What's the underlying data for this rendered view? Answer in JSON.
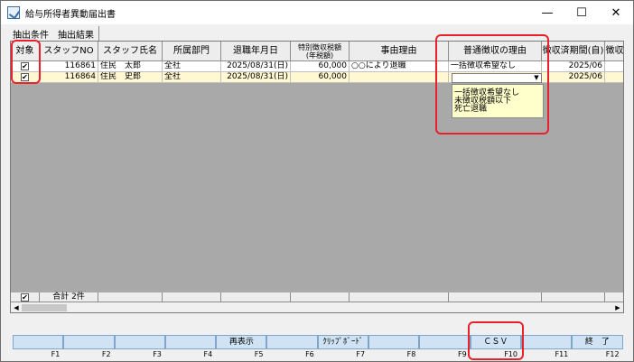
{
  "window": {
    "title": "給与所得者異動届出書",
    "minimize": "—",
    "maximize": "☐",
    "close": "✕"
  },
  "tabs": [
    {
      "label": "抽出条件"
    },
    {
      "label": "抽出結果"
    }
  ],
  "grid": {
    "columns": [
      {
        "label": "対象"
      },
      {
        "label": "スタッフNO"
      },
      {
        "label": "スタッフ氏名"
      },
      {
        "label": "所属部門"
      },
      {
        "label": "退職年月日"
      },
      {
        "label": "特別徴収税額",
        "label2": "(年税額)"
      },
      {
        "label": "事由理由"
      },
      {
        "label": "普通徴収の理由"
      },
      {
        "label": "徴収済期間(自)"
      },
      {
        "label": "徴収"
      }
    ],
    "rows": [
      {
        "checked": "✔",
        "staff_no": "116861",
        "name": "住民　太郎",
        "dept": "全社",
        "retire_date": "2025/08/31(日)",
        "tax": "60,000",
        "reason": "○○により退職",
        "normal_reason": "一括徴収希望なし",
        "period_from": "2025/06",
        "collect": ""
      },
      {
        "checked": "✔",
        "staff_no": "116864",
        "name": "住民　史郎",
        "dept": "全社",
        "retire_date": "2025/08/31(日)",
        "tax": "60,000",
        "reason": "",
        "normal_reason": "",
        "period_from": "2025/06",
        "collect": ""
      }
    ],
    "dropdown": {
      "arrow": "▼",
      "options": [
        "一括徴収希望なし",
        "未徴収税額以下",
        "死亡退職"
      ]
    },
    "summary": {
      "checked": "✔",
      "total": "合計 2件"
    },
    "scroll": {
      "left": "◀",
      "right": "▶"
    }
  },
  "fkeys": [
    {
      "label": "",
      "key": "F1"
    },
    {
      "label": "",
      "key": "F2"
    },
    {
      "label": "",
      "key": "F3"
    },
    {
      "label": "",
      "key": "F4"
    },
    {
      "label": "再表示",
      "key": "F5"
    },
    {
      "label": "",
      "key": "F6"
    },
    {
      "label": "ｸﾘｯﾌﾟﾎﾞｰﾄﾞ",
      "key": "F7"
    },
    {
      "label": "",
      "key": "F8"
    },
    {
      "label": "",
      "key": "F9"
    },
    {
      "label": "ＣＳＶ",
      "key": "F10"
    },
    {
      "label": "",
      "key": "F11"
    },
    {
      "label": "終　了",
      "key": "F12"
    }
  ],
  "colors": {
    "highlight": "#e8212b",
    "selected_row": "#fff8d2",
    "fkey_bg": "#cfe3f4",
    "dropdown_bg": "#ffffcc"
  }
}
